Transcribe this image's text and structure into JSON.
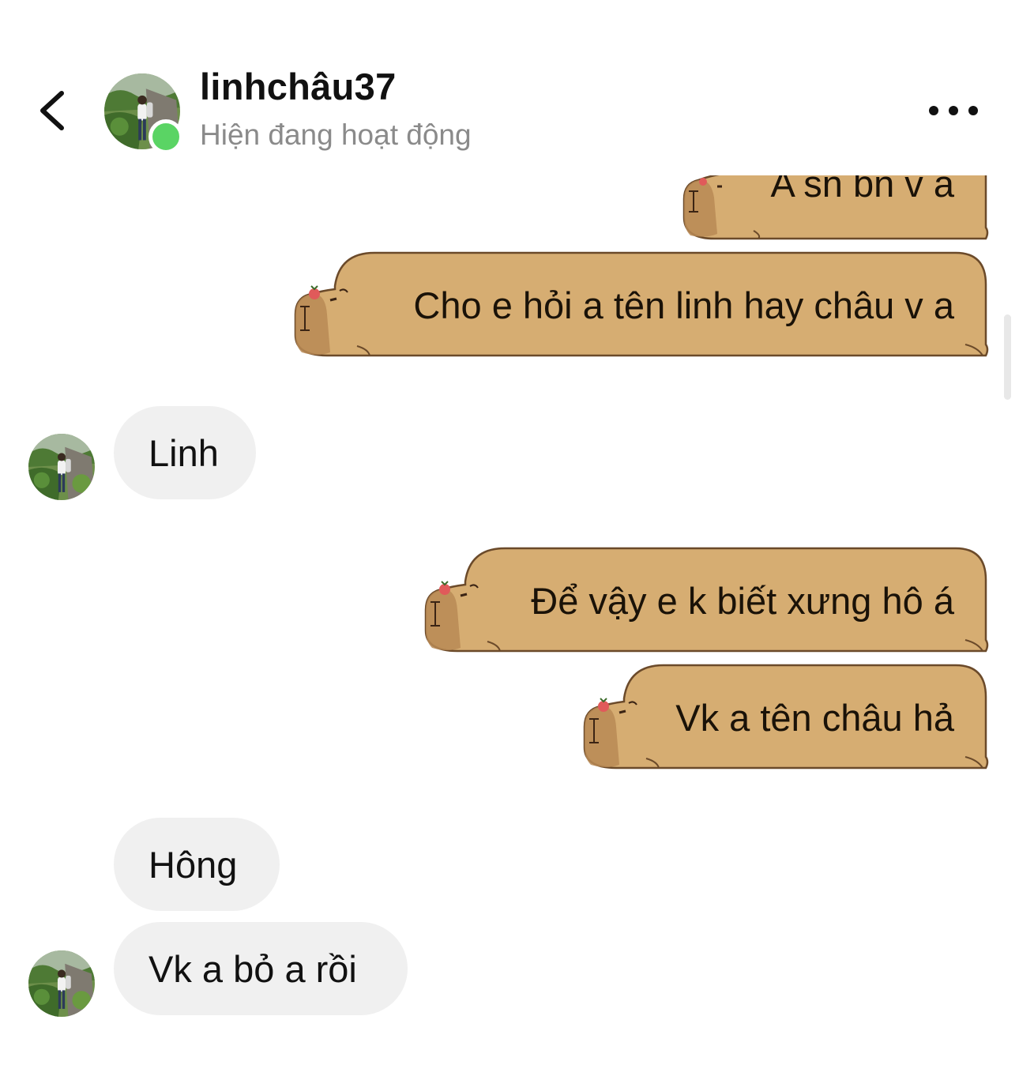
{
  "header": {
    "username": "linhchâu37",
    "status": "Hiện đang hoạt động",
    "back_icon": "chevron-left-icon",
    "more_icon": "more-horizontal-icon",
    "online_color": "#5ad464"
  },
  "messages": [
    {
      "direction": "sent",
      "text": "A sn bn v a",
      "style": "capybara-bubble",
      "partial": true
    },
    {
      "direction": "sent",
      "text": "Cho e hỏi a tên linh hay châu v a",
      "style": "capybara-bubble"
    },
    {
      "direction": "received",
      "text": "Linh",
      "show_avatar": true
    },
    {
      "direction": "sent",
      "text": "Để vậy e k biết xưng hô á",
      "style": "capybara-bubble"
    },
    {
      "direction": "sent",
      "text": "Vk a tên châu hả",
      "style": "capybara-bubble"
    },
    {
      "direction": "received",
      "text": "Hông",
      "show_avatar": false
    },
    {
      "direction": "received",
      "text": "Vk a bỏ a rồi",
      "show_avatar": true
    }
  ],
  "colors": {
    "capybara_fill": "#d6ad72",
    "capybara_outline": "#6b4a2a",
    "received_bubble": "#f0f0f0",
    "status_text": "#8a8a8a"
  }
}
